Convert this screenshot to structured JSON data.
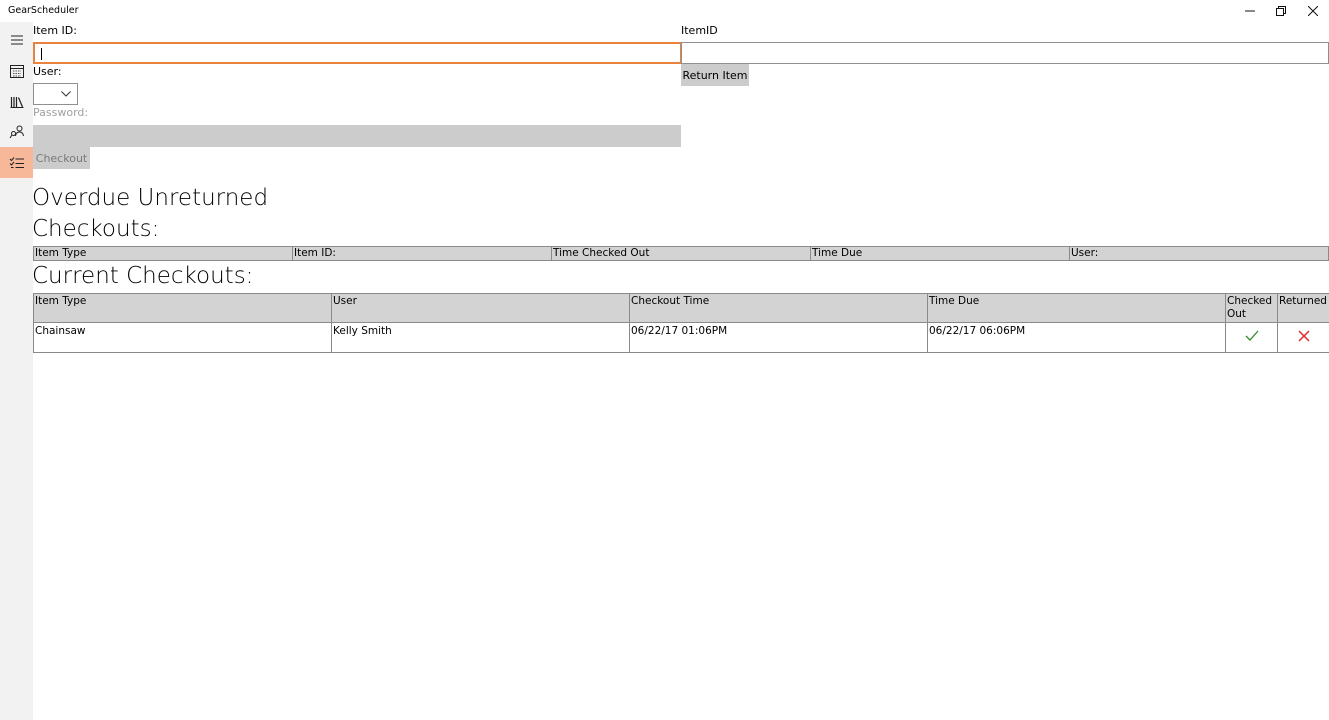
{
  "app": {
    "title": "GearScheduler"
  },
  "window_controls": {
    "minimize": "—",
    "restore": "❐",
    "close": "✕"
  },
  "sidebar": {
    "items": [
      {
        "icon": "hamburger-menu-icon"
      },
      {
        "icon": "calendar-icon"
      },
      {
        "icon": "library-books-icon"
      },
      {
        "icon": "people-search-icon"
      },
      {
        "icon": "checklist-icon",
        "active": true
      }
    ],
    "active_color": "#f6b899"
  },
  "checkout_form": {
    "item_id_label": "Item ID:",
    "item_id_value": "",
    "user_label": "User:",
    "user_value": "",
    "password_label": "Password:",
    "checkout_label": "Checkout"
  },
  "return_form": {
    "item_id_label": "ItemID",
    "item_id_value": "",
    "return_label": "Return Item"
  },
  "overdue": {
    "heading_line1": "Overdue Unreturned",
    "heading_line2": "Checkouts:",
    "columns": [
      "Item Type",
      "Item ID:",
      "Time Checked Out",
      "Time Due",
      "User:"
    ]
  },
  "current": {
    "heading": "Current Checkouts:",
    "columns": [
      "Item Type",
      "User",
      "Checkout Time",
      "Time Due",
      "Checked Out",
      "Returned"
    ],
    "rows": [
      {
        "item_type": "Chainsaw",
        "user": "Kelly Smith",
        "checkout_time": "06/22/17 01:06PM",
        "time_due": "06/22/17 06:06PM",
        "checked_out_icon": "checkmark-icon",
        "returned_icon": "x-mark-icon"
      }
    ]
  },
  "colors": {
    "accent_focus": "#e8823e",
    "check_green": "#2e8b2e",
    "x_red": "#e02020"
  }
}
